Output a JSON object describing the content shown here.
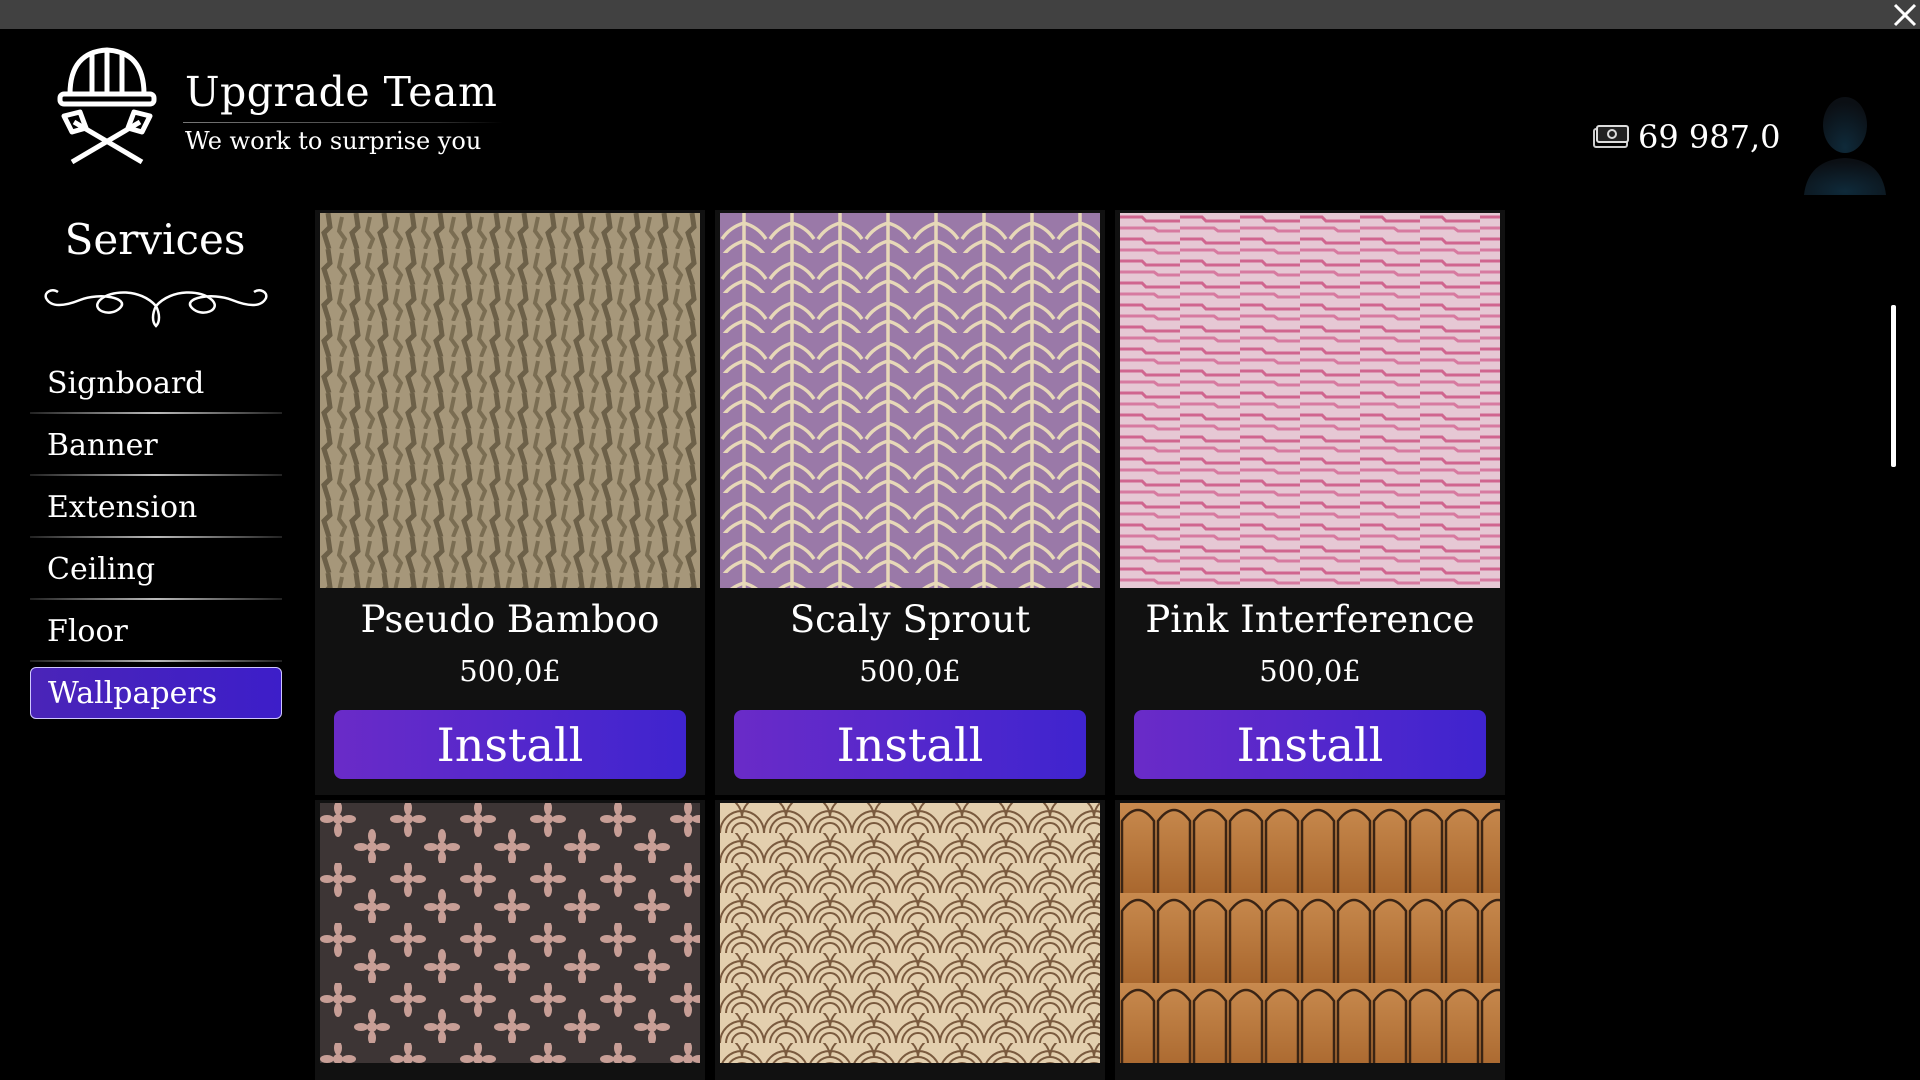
{
  "header": {
    "title": "Upgrade Team",
    "subtitle": "We work to surprise you",
    "money": "69 987,0",
    "icons": {
      "logo": "builder-helmet-hammers-icon",
      "money": "cash-icon",
      "avatar": "user-silhouette-icon",
      "close": "close-icon"
    }
  },
  "sidebar": {
    "title": "Services",
    "items": [
      {
        "label": "Signboard",
        "active": false
      },
      {
        "label": "Banner",
        "active": false
      },
      {
        "label": "Extension",
        "active": false
      },
      {
        "label": "Ceiling",
        "active": false
      },
      {
        "label": "Floor",
        "active": false
      },
      {
        "label": "Wallpapers",
        "active": true
      }
    ]
  },
  "products": [
    {
      "name": "Pseudo Bamboo",
      "price": "500,0£",
      "button": "Install"
    },
    {
      "name": "Scaly Sprout",
      "price": "500,0£",
      "button": "Install"
    },
    {
      "name": "Pink Interference",
      "price": "500,0£",
      "button": "Install"
    },
    {
      "name": "",
      "price": "",
      "button": ""
    },
    {
      "name": "",
      "price": "",
      "button": ""
    },
    {
      "name": "",
      "price": "",
      "button": ""
    }
  ],
  "colors": {
    "accent": "#4a24c8",
    "background": "#000000",
    "topbar": "#414141"
  }
}
